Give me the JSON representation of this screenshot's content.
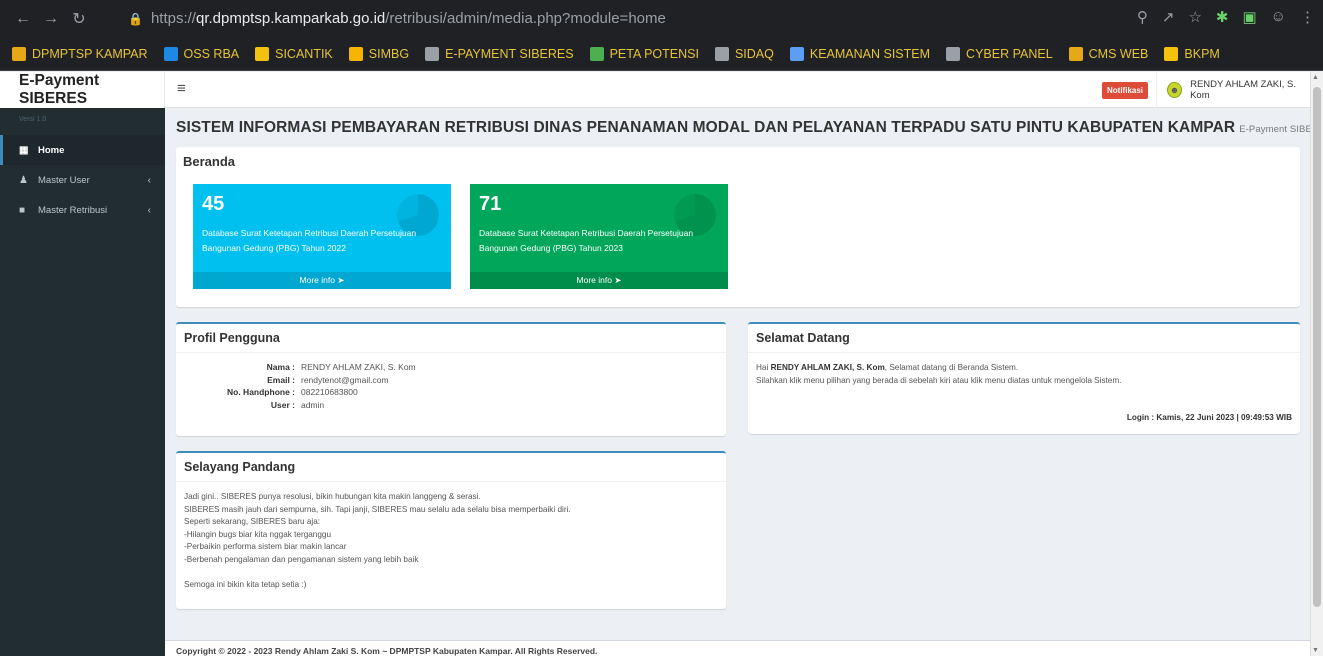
{
  "browser": {
    "url_scheme": "https://",
    "url_host": "qr.dpmptsp.kamparkab.go.id",
    "url_path": "/retribusi/admin/media.php?module=home",
    "bookmarks": [
      {
        "label": "DPMPTSP KAMPAR",
        "color": "#e6a817"
      },
      {
        "label": "OSS RBA",
        "color": "#1e88e5"
      },
      {
        "label": "SICANTIK",
        "color": "#f4c20d"
      },
      {
        "label": "SIMBG",
        "color": "#f4b400"
      },
      {
        "label": "E-PAYMENT SIBERES",
        "color": "#9aa0a6"
      },
      {
        "label": "PETA POTENSI",
        "color": "#4caf50"
      },
      {
        "label": "SIDAQ",
        "color": "#9aa0a6"
      },
      {
        "label": "KEAMANAN SISTEM",
        "color": "#5c9df5"
      },
      {
        "label": "CYBER PANEL",
        "color": "#9aa0a6"
      },
      {
        "label": "CMS WEB",
        "color": "#e6a817"
      },
      {
        "label": "BKPM",
        "color": "#f4c20d"
      }
    ]
  },
  "header": {
    "logo": "E-Payment SIBERES",
    "notification": "Notifikasi",
    "user_name": "RENDY AHLAM ZAKI, S. Kom"
  },
  "sidebar": {
    "version": "Versi 1.0",
    "items": [
      {
        "label": "Home",
        "icon": "grid-icon",
        "active": true
      },
      {
        "label": "Master User",
        "icon": "users-icon",
        "active": false
      },
      {
        "label": "Master Retribusi",
        "icon": "folder-icon",
        "active": false
      }
    ]
  },
  "main": {
    "title": "SISTEM INFORMASI PEMBAYARAN RETRIBUSI DINAS PENANAMAN MODAL DAN PELAYANAN TERPADU SATU PINTU KABUPATEN KAMPAR",
    "subtitle": "E-Payment SIBERES",
    "beranda": {
      "title": "Beranda",
      "cards": [
        {
          "count": "45",
          "desc": "Database Surat Ketetapan Retribusi Daerah Persetujuan Bangunan Gedung (PBG) Tahun 2022",
          "more": "More info",
          "color": "#00c0ef"
        },
        {
          "count": "71",
          "desc": "Database Surat Ketetapan Retribusi Daerah Persetujuan Bangunan Gedung (PBG) Tahun 2023",
          "more": "More info",
          "color": "#00a65a"
        }
      ]
    },
    "profile": {
      "title": "Profil Pengguna",
      "rows": [
        {
          "label": "Nama :",
          "value": "RENDY AHLAM ZAKI, S. Kom"
        },
        {
          "label": "Email :",
          "value": "rendytenot@gmail.com"
        },
        {
          "label": "No. Handphone :",
          "value": "082210683800"
        },
        {
          "label": "User :",
          "value": "admin"
        }
      ]
    },
    "welcome": {
      "title": "Selamat Datang",
      "greet_prefix": "Hai",
      "greet_name": "RENDY AHLAM ZAKI, S. Kom",
      "greet_suffix": ", Selamat datang di Beranda Sistem.",
      "line2": "Silahkan klik menu pilihan yang berada di sebelah kiri atau klik menu diatas untuk mengelola Sistem.",
      "login": "Login : Kamis, 22 Juni 2023 | 09:49:53 WIB"
    },
    "glance": {
      "title": "Selayang Pandang",
      "lines": [
        "Jadi gini.. SIBERES punya resolusi, bikin hubungan kita makin langgeng & serasi.",
        "SIBERES masih jauh dari sempurna, sih. Tapi janji, SIBERES mau selalu ada selalu bisa memperbaiki diri.",
        "Seperti sekarang, SIBERES baru aja:",
        "-Hilangin bugs biar kita nggak terganggu",
        "-Perbaikin performa sistem biar makin lancar",
        "-Berbenah pengalaman dan pengamanan sistem yang lebih baik"
      ],
      "closing": "Semoga ini bikin kita tetap setia :)"
    },
    "footer": "Copyright © 2022 - 2023 Rendy Ahlam Zaki S. Kom ~ DPMPTSP Kabupaten Kampar. All Rights Reserved."
  }
}
